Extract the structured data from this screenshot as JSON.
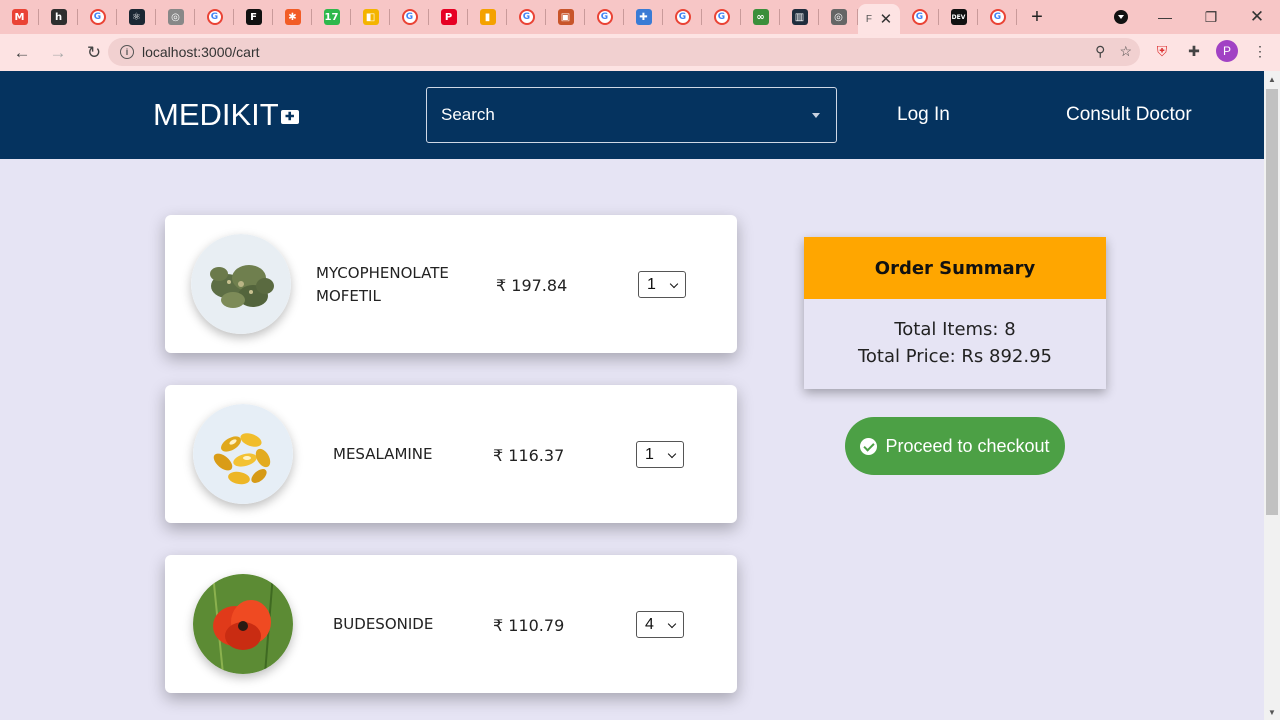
{
  "browser": {
    "url": "localhost:3000/cart",
    "active_tab_label": "F",
    "tabs": [
      {
        "icon": "gmail-icon",
        "glyph": "M",
        "color": "#ea4335"
      },
      {
        "icon": "hashnode-icon",
        "glyph": "h",
        "color": "#2e2e2e"
      },
      {
        "icon": "google-icon",
        "glyph": "G",
        "color": "#ffffff"
      },
      {
        "icon": "react-icon",
        "glyph": "⚛",
        "color": "#1b2733"
      },
      {
        "icon": "globe-icon",
        "glyph": "◎",
        "color": "#888888"
      },
      {
        "icon": "google-icon",
        "glyph": "G",
        "color": "#ffffff"
      },
      {
        "icon": "f-icon",
        "glyph": "F",
        "color": "#111111"
      },
      {
        "icon": "asterisk-icon",
        "glyph": "✱",
        "color": "#f25c26"
      },
      {
        "icon": "counter-icon",
        "glyph": "17",
        "color": "#2eb84c"
      },
      {
        "icon": "meet-icon",
        "glyph": "◧",
        "color": "#f4b400"
      },
      {
        "icon": "google-icon",
        "glyph": "G",
        "color": "#ffffff"
      },
      {
        "icon": "pinterest-icon",
        "glyph": "P",
        "color": "#e60023"
      },
      {
        "icon": "stripes-icon",
        "glyph": "▮",
        "color": "#f4a100"
      },
      {
        "icon": "google-icon",
        "glyph": "G",
        "color": "#ffffff"
      },
      {
        "icon": "square-icon",
        "glyph": "▣",
        "color": "#c8552a"
      },
      {
        "icon": "google-icon",
        "glyph": "G",
        "color": "#ffffff"
      },
      {
        "icon": "puzzle-app-icon",
        "glyph": "✚",
        "color": "#3a7bd5"
      },
      {
        "icon": "google-icon",
        "glyph": "G",
        "color": "#ffffff"
      },
      {
        "icon": "google-icon",
        "glyph": "G",
        "color": "#ffffff"
      },
      {
        "icon": "glasses-icon",
        "glyph": "∞",
        "color": "#3b8f3b"
      },
      {
        "icon": "trello-icon",
        "glyph": "▥",
        "color": "#1f2d3d"
      },
      {
        "icon": "globe-icon",
        "glyph": "◎",
        "color": "#666666"
      }
    ],
    "tabs_after": [
      {
        "icon": "google-icon",
        "glyph": "G",
        "color": "#ffffff"
      },
      {
        "icon": "dev-icon",
        "glyph": "DEV",
        "color": "#111111"
      },
      {
        "icon": "google-icon",
        "glyph": "G",
        "color": "#ffffff"
      }
    ],
    "avatar_letter": "P"
  },
  "navbar": {
    "brand": "MEDIKIT",
    "search_label": "Search",
    "login": "Log In",
    "consult": "Consult Doctor",
    "bg_color": "#05335f"
  },
  "cart": {
    "items": [
      {
        "name_line1": "MYCOPHENOLATE",
        "name_line2": "MOFETIL",
        "price": "₹ 197.84",
        "qty": "1",
        "image": "herb-image"
      },
      {
        "name_line1": "MESALAMINE",
        "name_line2": "",
        "price": "₹ 116.37",
        "qty": "1",
        "image": "capsules-image"
      },
      {
        "name_line1": "BUDESONIDE",
        "name_line2": "",
        "price": "₹ 110.79",
        "qty": "4",
        "image": "poppy-image"
      }
    ]
  },
  "summary": {
    "title": "Order Summary",
    "total_items": "Total Items: 8",
    "total_price": "Total Price: Rs 892.95",
    "header_color": "#ffa600"
  },
  "checkout": {
    "label": "Proceed to checkout",
    "color": "#4ca045"
  }
}
